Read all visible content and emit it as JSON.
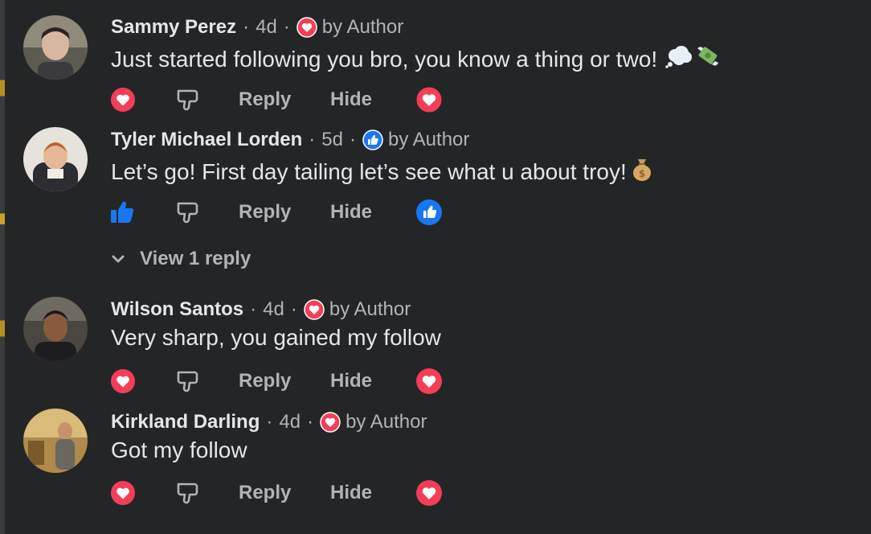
{
  "comments": [
    {
      "author": "Sammy Perez",
      "time": "4d",
      "reaction": "love",
      "by_author": "by Author",
      "text": "Just started following you bro, you know a thing or two!",
      "emojis": [
        "thought-bubble",
        "money-with-wings"
      ],
      "actions": {
        "reply": "Reply",
        "hide": "Hide"
      },
      "author_reaction": "love"
    },
    {
      "author": "Tyler Michael Lorden",
      "time": "5d",
      "reaction": "like",
      "by_author": "by Author",
      "text": "Let’s go! First day tailing let’s see what u about troy!",
      "emojis": [
        "money-bag"
      ],
      "actions": {
        "reply": "Reply",
        "hide": "Hide"
      },
      "author_reaction": "like"
    },
    {
      "author": "Wilson Santos",
      "time": "4d",
      "reaction": "love",
      "by_author": "by Author",
      "text": "Very sharp, you gained my follow",
      "emojis": [],
      "actions": {
        "reply": "Reply",
        "hide": "Hide"
      },
      "author_reaction": "love"
    },
    {
      "author": "Kirkland Darling",
      "time": "4d",
      "reaction": "love",
      "by_author": "by Author",
      "text": "Got my follow",
      "emojis": [],
      "actions": {
        "reply": "Reply",
        "hide": "Hide"
      },
      "author_reaction": "love"
    }
  ],
  "view_replies": "View 1 reply",
  "colors": {
    "background": "#242526",
    "text_primary": "#e4e6eb",
    "text_secondary": "#b0b3b8",
    "love": "#f33e58",
    "like": "#1877f2"
  }
}
